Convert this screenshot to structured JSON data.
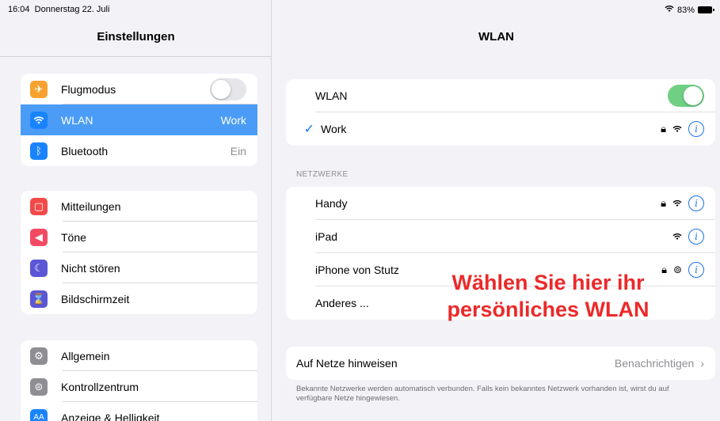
{
  "status": {
    "time": "16:04",
    "date": "Donnerstag 22. Juli",
    "battery": "83%"
  },
  "sidebar": {
    "title": "Einstellungen",
    "group1": [
      {
        "label": "Flugmodus",
        "icon": "airplane-icon",
        "color": "#f7a230",
        "toggle": false
      },
      {
        "label": "WLAN",
        "icon": "wifi-icon",
        "color": "#1a84ff",
        "value": "Work",
        "selected": true
      },
      {
        "label": "Bluetooth",
        "icon": "bluetooth-icon",
        "color": "#1a84ff",
        "value": "Ein"
      }
    ],
    "group2": [
      {
        "label": "Mitteilungen",
        "icon": "notifications-icon",
        "color": "#f24a4a"
      },
      {
        "label": "Töne",
        "icon": "sound-icon",
        "color": "#f24a63"
      },
      {
        "label": "Nicht stören",
        "icon": "moon-icon",
        "color": "#5a56d6"
      },
      {
        "label": "Bildschirmzeit",
        "icon": "hourglass-icon",
        "color": "#5a56d6"
      }
    ],
    "group3": [
      {
        "label": "Allgemein",
        "icon": "gear-icon",
        "color": "#8e8e93"
      },
      {
        "label": "Kontrollzentrum",
        "icon": "control-center-icon",
        "color": "#8e8e93"
      },
      {
        "label": "Anzeige & Helligkeit",
        "icon": "display-icon",
        "color": "#1a84ff"
      }
    ]
  },
  "main": {
    "title": "WLAN",
    "wlan_label": "WLAN",
    "wlan_on": true,
    "connected": "Work",
    "networks_header": "NETZWERKE",
    "networks": [
      {
        "name": "Handy",
        "locked": true,
        "signal": "wifi"
      },
      {
        "name": "iPad",
        "locked": false,
        "signal": "wifi"
      },
      {
        "name": "iPhone von Stutz",
        "locked": true,
        "signal": "hotspot"
      },
      {
        "name": "Anderes ...",
        "locked": false,
        "signal": "none"
      }
    ],
    "ask_label": "Auf Netze hinweisen",
    "ask_value": "Benachrichtigen",
    "footnote": "Bekannte Netzwerke werden automatisch verbunden. Falls kein bekanntes Netzwerk vorhanden ist, wirst du auf verfügbare Netze hingewiesen."
  },
  "overlay": {
    "line1": "Wählen Sie hier ihr",
    "line2": "persönliches WLAN",
    "color": "#ec2929"
  },
  "colors": {
    "accent": "#1a73e8",
    "toggle_on": "#6fd083",
    "selected_row": "#4a9cf6"
  }
}
